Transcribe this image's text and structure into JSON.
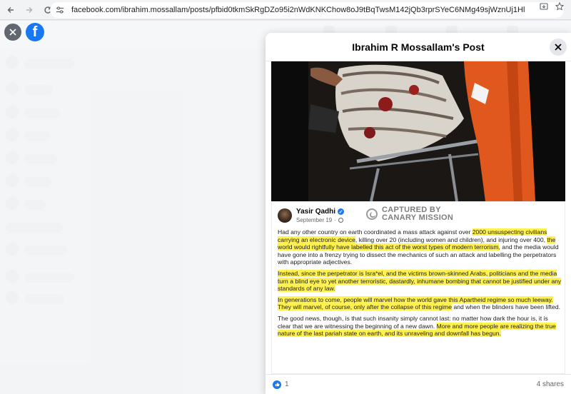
{
  "browser": {
    "url": "facebook.com/ibrahim.mossallam/posts/pfbid0tkmSkRgDZo95i2nWdKNKChow8oJ9tBqTwsM142jQb3rprSYeC6NMg49sjWznUj1Hl",
    "back_icon": "arrow-left",
    "forward_icon": "arrow-right",
    "reload_icon": "reload",
    "site_settings_icon": "tune"
  },
  "modal": {
    "title": "Ibrahim R Mossallam's Post"
  },
  "post": {
    "author": "Yasir Qadhi",
    "date": "September 19",
    "watermark_line1": "CAPTURED BY",
    "watermark_line2": "CANARY MISSION",
    "paragraphs": [
      [
        {
          "t": "Had any other country on earth coordinated a mass attack against over ",
          "h": false
        },
        {
          "t": "2000 unsuspecting civilians carrying an electronic device",
          "h": true
        },
        {
          "t": ", killing over 20 (including women and children), and injuring over 400, ",
          "h": false
        },
        {
          "t": "the world would rightfully have labelled this act of the worst types of modern terrorism",
          "h": true
        },
        {
          "t": ", and the media would have gone into a frenzy trying to dissect the mechanics of such an attack and labelling the perpetrators with appropriate adjectives.",
          "h": false
        }
      ],
      [
        {
          "t": "Instead, since the perpetrator is Isra*el, and the victims brown-skinned Arabs, politicians and the media turn a blind eye to yet another terroristic, dastardly, inhumane bombing that cannot be justified under any standards of any law.",
          "h": true
        }
      ],
      [
        {
          "t": "In generations to come, people will marvel how the world gave this Apartheid regime so much leeway. They will marvel, of course, only after the collapse of this regime",
          "h": true
        },
        {
          "t": " and when the blinders have been lifted.",
          "h": false
        }
      ],
      [
        {
          "t": "The good news, though, is that such insanity simply cannot last: no matter how dark the hour is, it is clear that we are witnessing the beginning of a new dawn. ",
          "h": false
        },
        {
          "t": "More and more people are realizing the true nature of the last pariah state on earth, and its unraveling and downfall has begun.",
          "h": true
        }
      ]
    ]
  },
  "footer": {
    "likes": "1",
    "shares": "4 shares"
  },
  "colors": {
    "highlight": "#fff250",
    "facebook_blue": "#1877f2"
  }
}
